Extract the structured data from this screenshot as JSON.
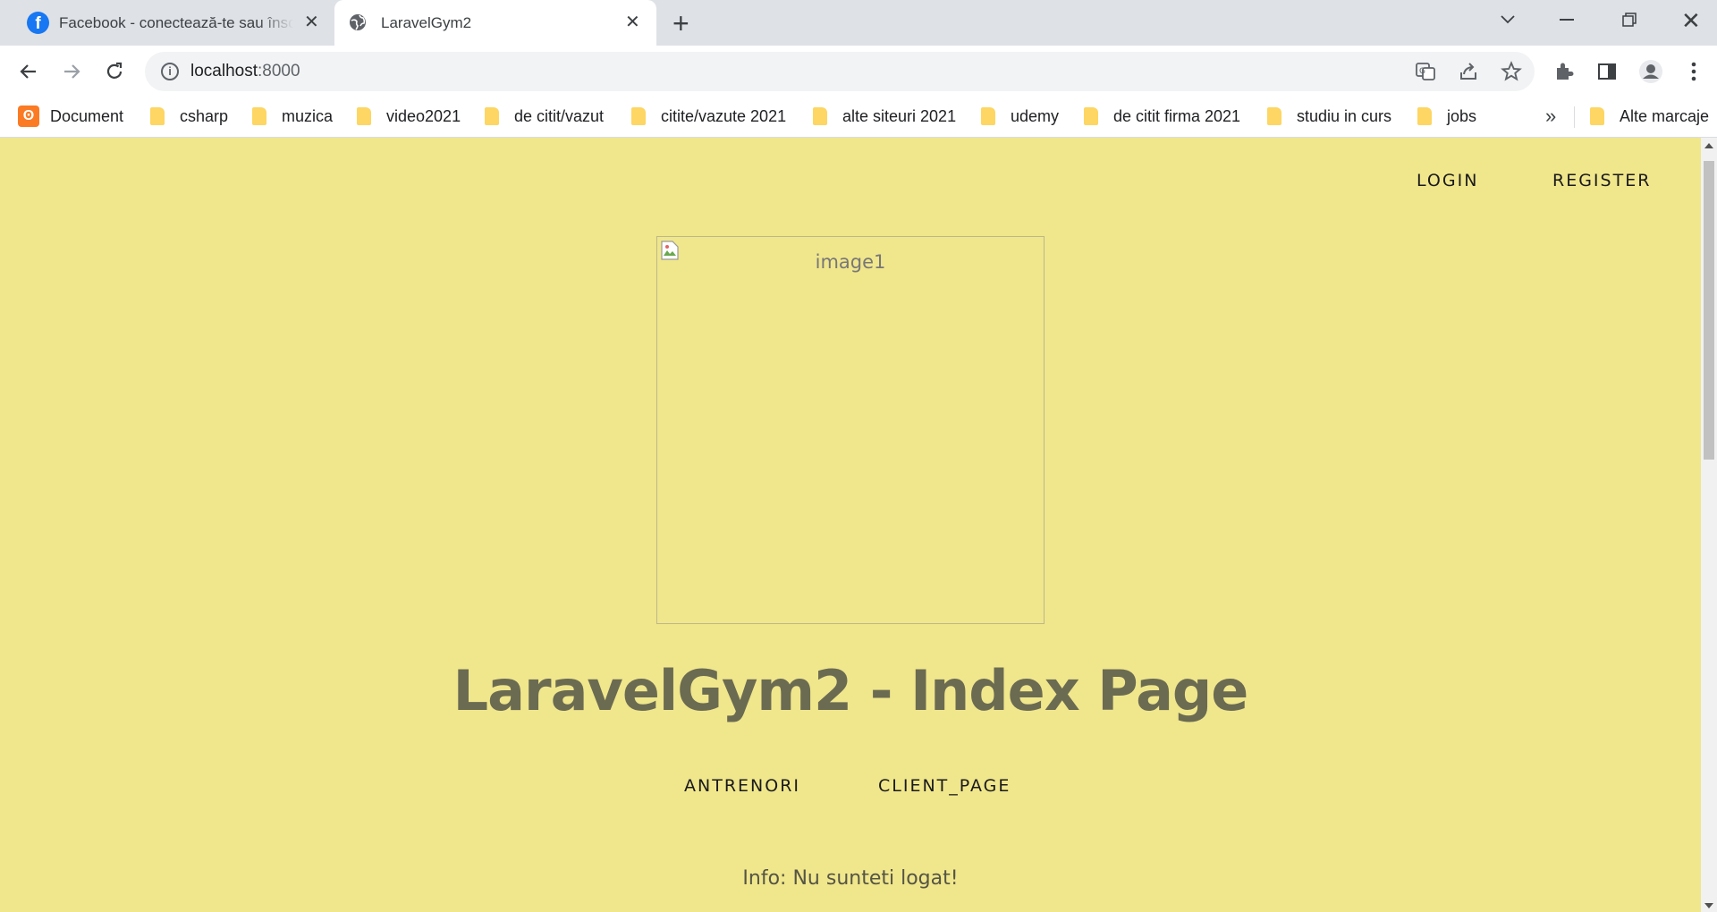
{
  "tabs": [
    {
      "title": "Facebook - conectează-te sau înscrie-te",
      "active": false,
      "favicon": "facebook-icon"
    },
    {
      "title": "LaravelGym2",
      "active": true,
      "favicon": "globe-icon"
    }
  ],
  "toolbar": {
    "url_host": "localhost",
    "url_port": ":8000"
  },
  "bookmarks": {
    "items": [
      {
        "label": "Document",
        "icon": "xampp-icon"
      },
      {
        "label": "csharp",
        "icon": "folder-icon"
      },
      {
        "label": "muzica",
        "icon": "folder-icon"
      },
      {
        "label": "video2021",
        "icon": "folder-icon"
      },
      {
        "label": "de citit/vazut",
        "icon": "folder-icon"
      },
      {
        "label": "citite/vazute 2021",
        "icon": "folder-icon"
      },
      {
        "label": "alte siteuri 2021",
        "icon": "folder-icon"
      },
      {
        "label": "udemy",
        "icon": "folder-icon"
      },
      {
        "label": "de citit firma 2021",
        "icon": "folder-icon"
      },
      {
        "label": "studiu in curs",
        "icon": "folder-icon"
      },
      {
        "label": "jobs",
        "icon": "folder-icon"
      }
    ],
    "more": "»",
    "other": "Alte marcaje"
  },
  "page": {
    "background": "#f0e68c",
    "nav": {
      "login": "LOGIN",
      "register": "REGISTER"
    },
    "image_alt": "image1",
    "title": "LaravelGym2 - Index Page",
    "menu": {
      "antrenori": "ANTRENORI",
      "client_page": "CLIENT_PAGE"
    },
    "info": "Info: Nu sunteti logat!"
  }
}
